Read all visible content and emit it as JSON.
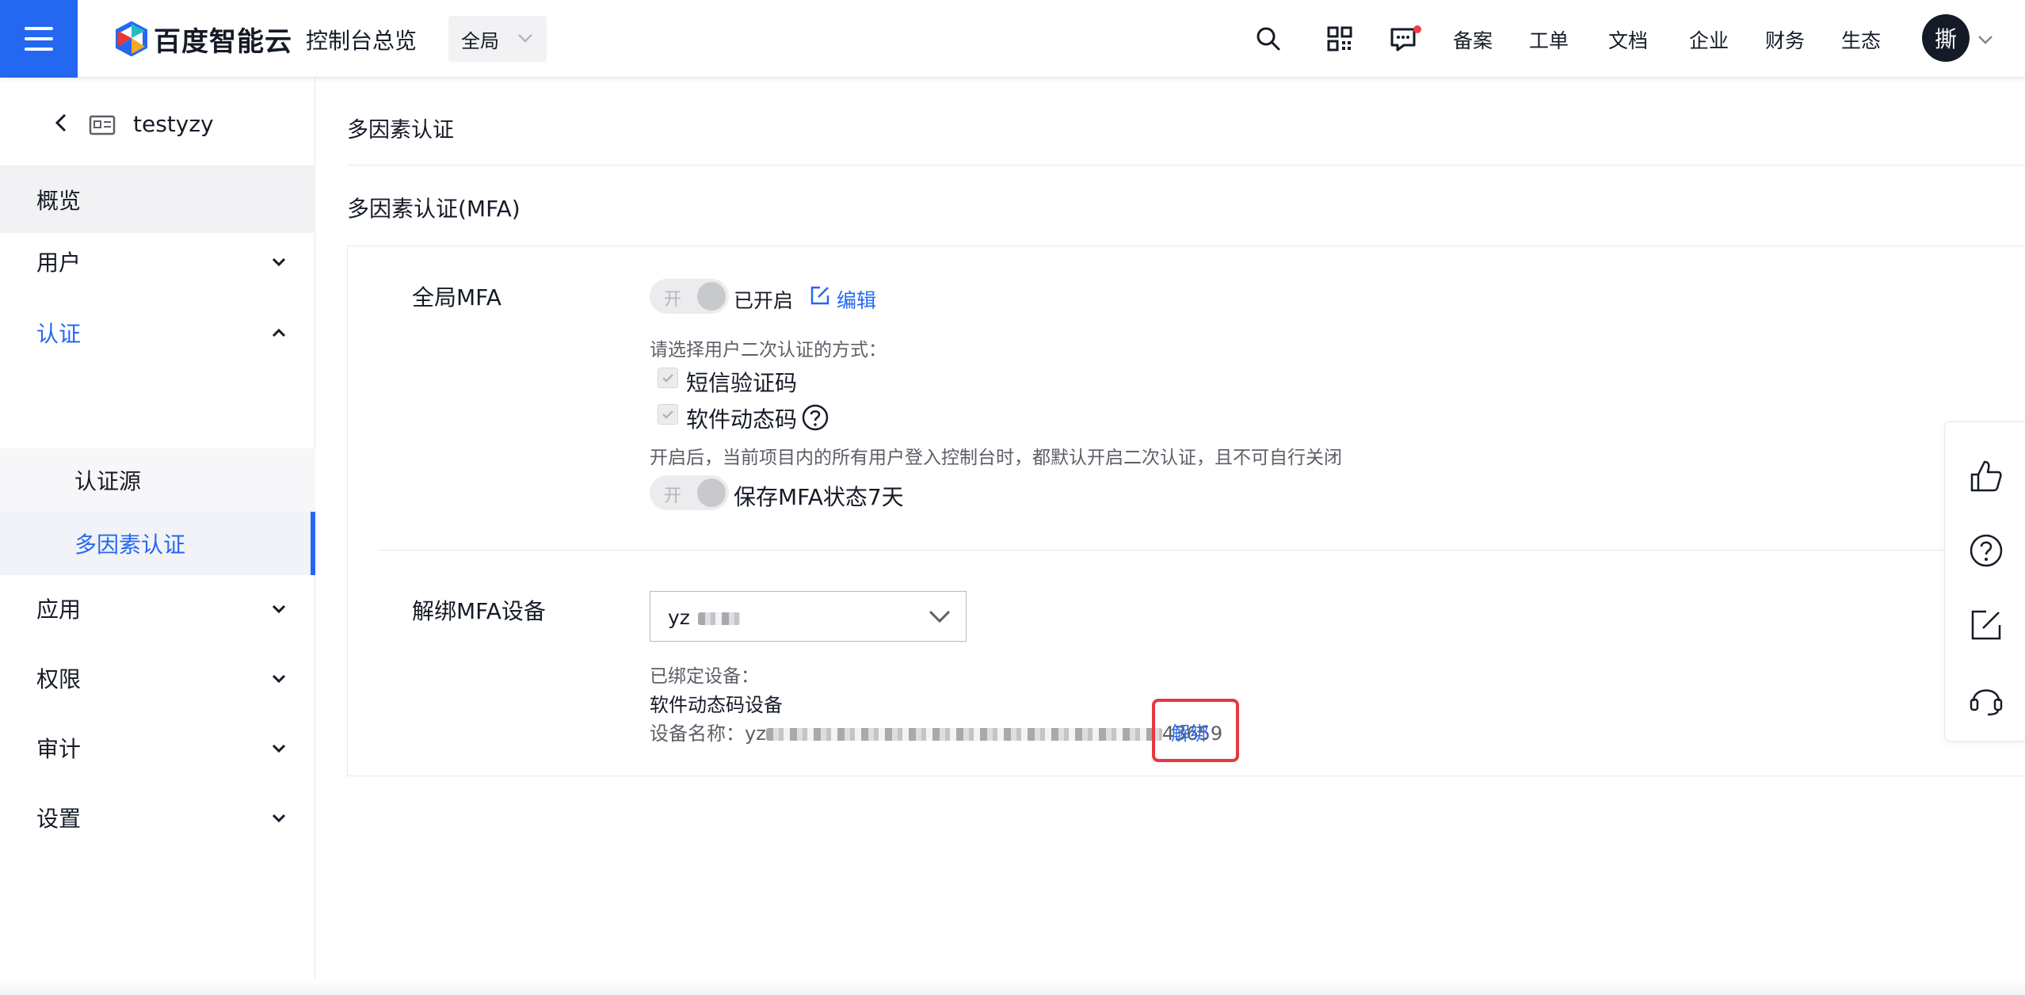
{
  "header": {
    "logo_text": "百度智能云",
    "console_label": "控制台总览",
    "scope_label": "全局",
    "links": [
      "备案",
      "工单",
      "文档",
      "企业",
      "财务",
      "生态"
    ],
    "avatar_initial": "撕",
    "icons": [
      "menu-icon",
      "search-icon",
      "qrcode-icon",
      "message-icon",
      "chevron-down-icon"
    ]
  },
  "sidebar": {
    "project_name": "testyzy",
    "items": [
      {
        "label": "概览"
      },
      {
        "label": "用户"
      },
      {
        "label": "认证"
      },
      {
        "label": "认证源"
      },
      {
        "label": "多因素认证"
      },
      {
        "label": "应用"
      },
      {
        "label": "权限"
      },
      {
        "label": "审计"
      },
      {
        "label": "设置"
      }
    ]
  },
  "main": {
    "page_title": "多因素认证",
    "section_title": "多因素认证(MFA)",
    "global_mfa": {
      "label": "全局MFA",
      "switch_text": "开",
      "status": "已开启",
      "edit_label": "编辑",
      "method_prompt": "请选择用户二次认证的方式：",
      "methods": [
        "短信验证码",
        "软件动态码"
      ],
      "note": "开启后，当前项目内的所有用户登入控制台时，都默认开启二次认证，且不可自行关闭",
      "keep_switch_text": "开",
      "keep_label": "保存MFA状态7天"
    },
    "unbind": {
      "label": "解绑MFA设备",
      "select_value": "yz",
      "bound_label": "已绑定设备：",
      "device_type": "软件动态码设备",
      "device_name_label": "设备名称：",
      "device_name_prefix": "yz",
      "device_name_suffix": "43659",
      "unbind_label": "解绑"
    }
  },
  "float_toolbar": {
    "icons": [
      "thumbs-up-icon",
      "help-icon",
      "feedback-edit-icon",
      "headset-icon"
    ]
  },
  "colors": {
    "brand": "#2468f2",
    "highlight": "#e5393d",
    "notification_dot": "#f33e3e"
  }
}
